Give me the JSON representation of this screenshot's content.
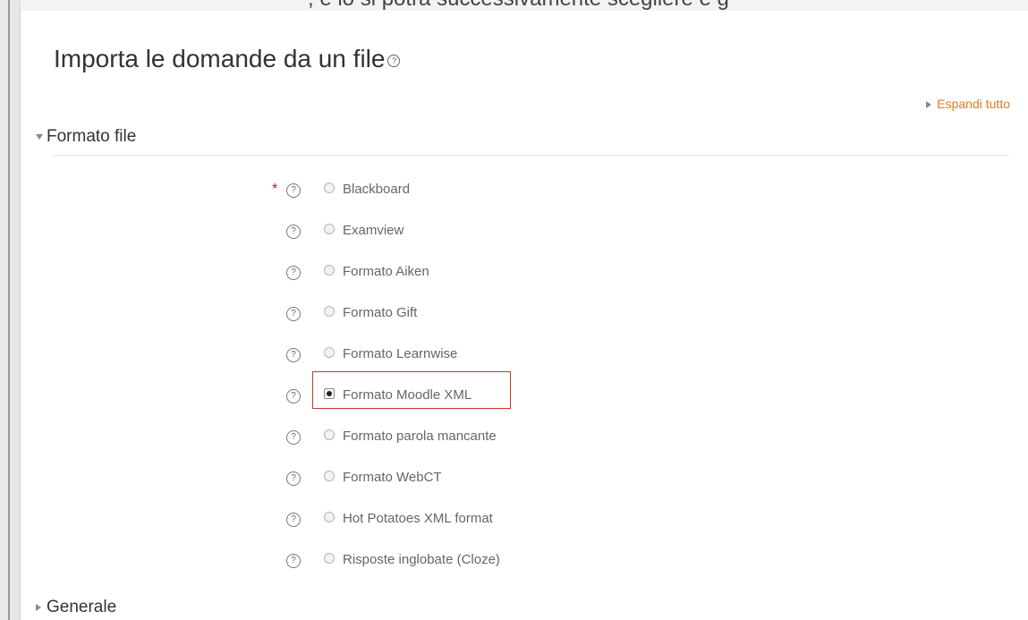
{
  "top_fragment": ", e lo si potrà successivamente scegliere e g",
  "page": {
    "title": "Importa le domande da un file",
    "expand_all": "Espandi tutto"
  },
  "sections": {
    "format": "Formato file",
    "general": "Generale"
  },
  "help_glyph": "?",
  "required_marker": "*",
  "options": [
    {
      "label": "Blackboard",
      "selected": false
    },
    {
      "label": "Examview",
      "selected": false
    },
    {
      "label": "Formato Aiken",
      "selected": false
    },
    {
      "label": "Formato Gift",
      "selected": false
    },
    {
      "label": "Formato Learnwise",
      "selected": false
    },
    {
      "label": "Formato Moodle XML",
      "selected": true
    },
    {
      "label": "Formato parola mancante",
      "selected": false
    },
    {
      "label": "Formato WebCT",
      "selected": false
    },
    {
      "label": "Hot Potatoes XML format",
      "selected": false
    },
    {
      "label": "Risposte inglobate (Cloze)",
      "selected": false
    }
  ],
  "colors": {
    "link": "#e07b26",
    "required": "#c8102e",
    "highlight": "#c0392b"
  }
}
